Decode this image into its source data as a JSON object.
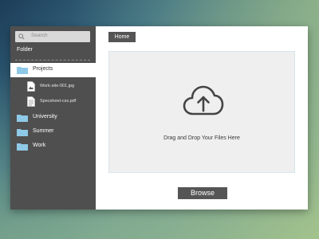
{
  "sidebar": {
    "search_placeholder": "Search",
    "section_label": "Folder",
    "items": [
      {
        "label": "Projects",
        "icon": "folder-icon",
        "active": true
      },
      {
        "label": "University",
        "icon": "folder-icon",
        "active": false
      },
      {
        "label": "Summer",
        "icon": "folder-icon",
        "active": false
      },
      {
        "label": "Work",
        "icon": "folder-icon",
        "active": false
      }
    ],
    "files": [
      {
        "name": "Work-site-001.jpg",
        "icon": "image-file-icon"
      },
      {
        "name": "Specsheet-css.pdf",
        "icon": "document-file-icon"
      }
    ]
  },
  "main": {
    "breadcrumb_home": "Home",
    "dropzone_text": "Drag and Drop Your Files Here",
    "browse_label": "Browse"
  },
  "colors": {
    "sidebar_bg": "#4f4f4f",
    "folder_accent": "#8fc9e8",
    "button_bg": "#555555",
    "dropzone_bg": "#efefef"
  }
}
